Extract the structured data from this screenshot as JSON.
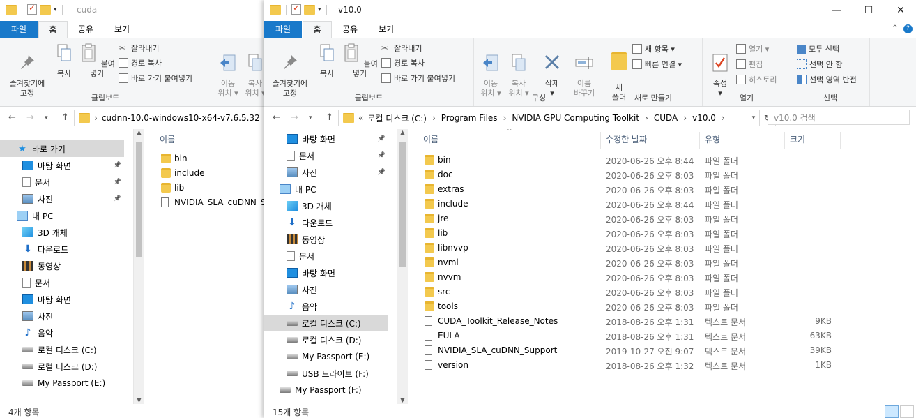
{
  "left_window": {
    "title": "cuda",
    "tabs": [
      "파일",
      "홈",
      "공유",
      "보기"
    ],
    "ribbon": {
      "clipboard": {
        "pin_label": "즐겨찾기에\n고정",
        "copy_label": "복사",
        "paste_label": "붙여넣기",
        "cut_label": "잘라내기",
        "copy_path_label": "경로 복사",
        "paste_shortcut_label": "바로 가기 붙여넣기",
        "group_label": "클립보드"
      },
      "organize": {
        "move_label": "이동\n위치 ▾",
        "copy_to_label": "복사\n위치 ▾"
      }
    },
    "address": "cudnn-10.0-windows10-x64-v7.6.5.32",
    "nav_items": [
      {
        "label": "바로 가기",
        "icon": "star-icon",
        "pinned": false,
        "indent": 0
      },
      {
        "label": "바탕 화면",
        "icon": "desktop-icon",
        "pinned": true,
        "indent": 1
      },
      {
        "label": "문서",
        "icon": "documents-icon",
        "pinned": true,
        "indent": 1
      },
      {
        "label": "사진",
        "icon": "pictures-icon",
        "pinned": true,
        "indent": 1
      },
      {
        "label": "내 PC",
        "icon": "pc-icon",
        "pinned": false,
        "indent": 0
      },
      {
        "label": "3D 개체",
        "icon": "3d-objects-icon",
        "pinned": false,
        "indent": 1
      },
      {
        "label": "다운로드",
        "icon": "download-icon",
        "pinned": false,
        "indent": 1
      },
      {
        "label": "동영상",
        "icon": "video-icon",
        "pinned": false,
        "indent": 1
      },
      {
        "label": "문서",
        "icon": "documents-icon",
        "pinned": false,
        "indent": 1
      },
      {
        "label": "바탕 화면",
        "icon": "desktop-icon",
        "pinned": false,
        "indent": 1
      },
      {
        "label": "사진",
        "icon": "pictures-icon",
        "pinned": false,
        "indent": 1
      },
      {
        "label": "음악",
        "icon": "music-icon",
        "pinned": false,
        "indent": 1
      },
      {
        "label": "로컬 디스크 (C:)",
        "icon": "drive-icon",
        "pinned": false,
        "indent": 1
      },
      {
        "label": "로컬 디스크 (D:)",
        "icon": "drive-icon",
        "pinned": false,
        "indent": 1
      },
      {
        "label": "My Passport (E:)",
        "icon": "drive-icon",
        "pinned": false,
        "indent": 1
      }
    ],
    "column_name": "이름",
    "files": [
      {
        "name": "bin",
        "type": "folder"
      },
      {
        "name": "include",
        "type": "folder"
      },
      {
        "name": "lib",
        "type": "folder"
      },
      {
        "name": "NVIDIA_SLA_cuDNN_Support",
        "type": "file"
      }
    ],
    "status": "4개 항목"
  },
  "right_window": {
    "title": "v10.0",
    "tabs": [
      "파일",
      "홈",
      "공유",
      "보기"
    ],
    "ribbon": {
      "clipboard": {
        "pin_label": "즐겨찾기에\n고정",
        "copy_label": "복사",
        "paste_label": "붙여넣기",
        "cut_label": "잘라내기",
        "copy_path_label": "경로 복사",
        "paste_shortcut_label": "바로 가기 붙여넣기",
        "group_label": "클립보드"
      },
      "organize": {
        "move_label": "이동\n위치 ▾",
        "copy_to_label": "복사\n위치 ▾",
        "delete_label": "삭제\n▾",
        "rename_label": "이름\n바꾸기",
        "group_label": "구성"
      },
      "new": {
        "new_folder_label": "새\n폴더",
        "new_item_label": "새 항목 ▾",
        "easy_access_label": "빠른 연결 ▾",
        "group_label": "새로 만들기"
      },
      "open": {
        "properties_label": "속성\n▾",
        "open_label": "열기 ▾",
        "edit_label": "편집",
        "history_label": "히스토리",
        "group_label": "열기"
      },
      "select": {
        "select_all_label": "모두 선택",
        "select_none_label": "선택 안 함",
        "invert_label": "선택 영역 반전",
        "group_label": "선택"
      }
    },
    "breadcrumb": [
      "로컬 디스크 (C:)",
      "Program Files",
      "NVIDIA GPU Computing Toolkit",
      "CUDA",
      "v10.0"
    ],
    "search_placeholder": "v10.0 검색",
    "nav_items": [
      {
        "label": "바탕 화면",
        "icon": "desktop-icon",
        "pinned": true,
        "indent": 1
      },
      {
        "label": "문서",
        "icon": "documents-icon",
        "pinned": true,
        "indent": 1
      },
      {
        "label": "사진",
        "icon": "pictures-icon",
        "pinned": true,
        "indent": 1
      },
      {
        "label": "내 PC",
        "icon": "pc-icon",
        "pinned": false,
        "indent": 0
      },
      {
        "label": "3D 개체",
        "icon": "3d-objects-icon",
        "pinned": false,
        "indent": 1
      },
      {
        "label": "다운로드",
        "icon": "download-icon",
        "pinned": false,
        "indent": 1
      },
      {
        "label": "동영상",
        "icon": "video-icon",
        "pinned": false,
        "indent": 1
      },
      {
        "label": "문서",
        "icon": "documents-icon",
        "pinned": false,
        "indent": 1
      },
      {
        "label": "바탕 화면",
        "icon": "desktop-icon",
        "pinned": false,
        "indent": 1
      },
      {
        "label": "사진",
        "icon": "pictures-icon",
        "pinned": false,
        "indent": 1
      },
      {
        "label": "음악",
        "icon": "music-icon",
        "pinned": false,
        "indent": 1
      },
      {
        "label": "로컬 디스크 (C:)",
        "icon": "drive-icon",
        "pinned": false,
        "indent": 1
      },
      {
        "label": "로컬 디스크 (D:)",
        "icon": "drive-icon",
        "pinned": false,
        "indent": 1
      },
      {
        "label": "My Passport (E:)",
        "icon": "drive-icon",
        "pinned": false,
        "indent": 1
      },
      {
        "label": "USB 드라이브 (F:)",
        "icon": "usb-icon",
        "pinned": false,
        "indent": 1
      },
      {
        "label": "My Passport (F:)",
        "icon": "drive-icon",
        "pinned": false,
        "indent": 0
      }
    ],
    "columns": [
      "이름",
      "수정한 날짜",
      "유형",
      "크기"
    ],
    "files": [
      {
        "name": "bin",
        "date": "2020-06-26 오후 8:44",
        "type": "파일 폴더",
        "size": "",
        "kind": "folder"
      },
      {
        "name": "doc",
        "date": "2020-06-26 오후 8:03",
        "type": "파일 폴더",
        "size": "",
        "kind": "folder"
      },
      {
        "name": "extras",
        "date": "2020-06-26 오후 8:03",
        "type": "파일 폴더",
        "size": "",
        "kind": "folder"
      },
      {
        "name": "include",
        "date": "2020-06-26 오후 8:44",
        "type": "파일 폴더",
        "size": "",
        "kind": "folder"
      },
      {
        "name": "jre",
        "date": "2020-06-26 오후 8:03",
        "type": "파일 폴더",
        "size": "",
        "kind": "folder"
      },
      {
        "name": "lib",
        "date": "2020-06-26 오후 8:03",
        "type": "파일 폴더",
        "size": "",
        "kind": "folder"
      },
      {
        "name": "libnvvp",
        "date": "2020-06-26 오후 8:03",
        "type": "파일 폴더",
        "size": "",
        "kind": "folder"
      },
      {
        "name": "nvml",
        "date": "2020-06-26 오후 8:03",
        "type": "파일 폴더",
        "size": "",
        "kind": "folder"
      },
      {
        "name": "nvvm",
        "date": "2020-06-26 오후 8:03",
        "type": "파일 폴더",
        "size": "",
        "kind": "folder"
      },
      {
        "name": "src",
        "date": "2020-06-26 오후 8:03",
        "type": "파일 폴더",
        "size": "",
        "kind": "folder"
      },
      {
        "name": "tools",
        "date": "2020-06-26 오후 8:03",
        "type": "파일 폴더",
        "size": "",
        "kind": "folder"
      },
      {
        "name": "CUDA_Toolkit_Release_Notes",
        "date": "2018-08-26 오후 1:31",
        "type": "텍스트 문서",
        "size": "9KB",
        "kind": "file"
      },
      {
        "name": "EULA",
        "date": "2018-08-26 오후 1:31",
        "type": "텍스트 문서",
        "size": "63KB",
        "kind": "file"
      },
      {
        "name": "NVIDIA_SLA_cuDNN_Support",
        "date": "2019-10-27 오전 9:07",
        "type": "텍스트 문서",
        "size": "39KB",
        "kind": "file"
      },
      {
        "name": "version",
        "date": "2018-08-26 오후 1:32",
        "type": "텍스트 문서",
        "size": "1KB",
        "kind": "file"
      }
    ],
    "status": "15개 항목"
  }
}
